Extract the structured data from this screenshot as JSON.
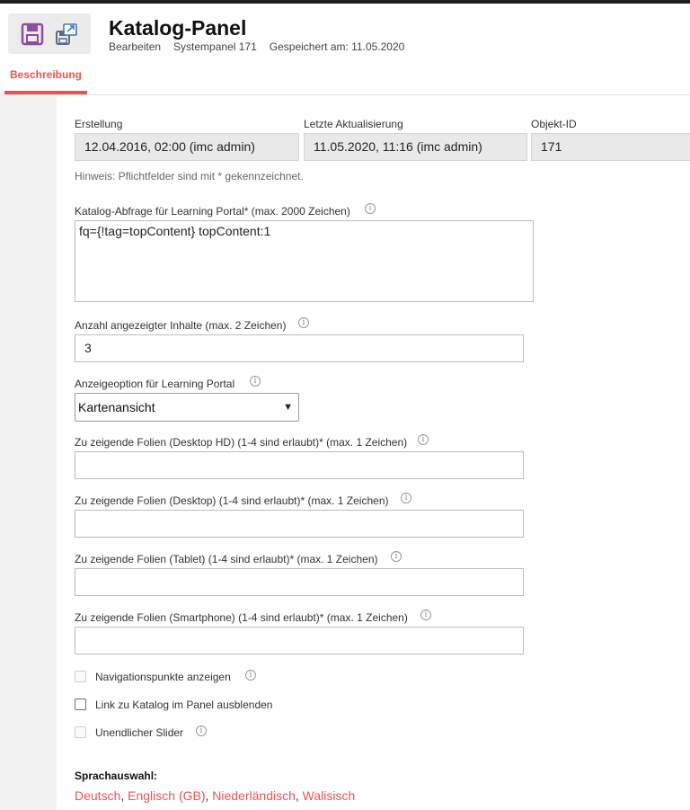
{
  "header": {
    "title": "Katalog-Panel",
    "meta": [
      "Bearbeiten",
      "Systempanel 171",
      "Gespeichert am: 11.05.2020"
    ]
  },
  "toolbar": {
    "save_icon": "floppy-disk-icon",
    "save_as_icon": "save-export-icon"
  },
  "tabs": [
    {
      "label": "Beschreibung",
      "active": true
    }
  ],
  "info_fields": [
    {
      "label": "Erstellung",
      "value": "12.04.2016, 02:00 (imc admin)"
    },
    {
      "label": "Letzte Aktualisierung",
      "value": "11.05.2020, 11:16 (imc admin)"
    },
    {
      "label": "Objekt-ID",
      "value": "171"
    }
  ],
  "hint": "Hinweis: Pflichtfelder sind mit * gekennzeichnet.",
  "query": {
    "label": "Katalog-Abfrage für Learning Portal* (max. 2000 Zeichen)",
    "value": "fq={!tag=topContent} topContent:1"
  },
  "count": {
    "label": "Anzahl angezeigter Inhalte (max. 2 Zeichen)",
    "value": "3"
  },
  "display": {
    "label": "Anzeigeoption für Learning Portal",
    "value": "Kartenansicht"
  },
  "slides": [
    {
      "label": "Zu zeigende Folien (Desktop HD) (1-4 sind erlaubt)* (max. 1 Zeichen)",
      "value": ""
    },
    {
      "label": "Zu zeigende Folien (Desktop) (1-4 sind erlaubt)* (max. 1 Zeichen)",
      "value": ""
    },
    {
      "label": "Zu zeigende Folien (Tablet) (1-4 sind erlaubt)* (max. 1 Zeichen)",
      "value": ""
    },
    {
      "label": "Zu zeigende Folien (Smartphone) (1-4 sind erlaubt)* (max. 1 Zeichen)",
      "value": ""
    }
  ],
  "checkboxes": [
    {
      "label": "Navigationspunkte anzeigen",
      "checked": false,
      "enabled": false
    },
    {
      "label": "Link zu Katalog im Panel ausblenden",
      "checked": false,
      "enabled": true
    },
    {
      "label": "Unendlicher Slider",
      "checked": false,
      "enabled": false
    }
  ],
  "languages": {
    "title": "Sprachauswahl:",
    "items": [
      "Deutsch",
      "Englisch (GB)",
      "Niederländisch",
      "Walisisch"
    ],
    "separator": ", "
  },
  "colors": {
    "accent": "#e8544f",
    "save_icon": "#8e4ea0"
  }
}
